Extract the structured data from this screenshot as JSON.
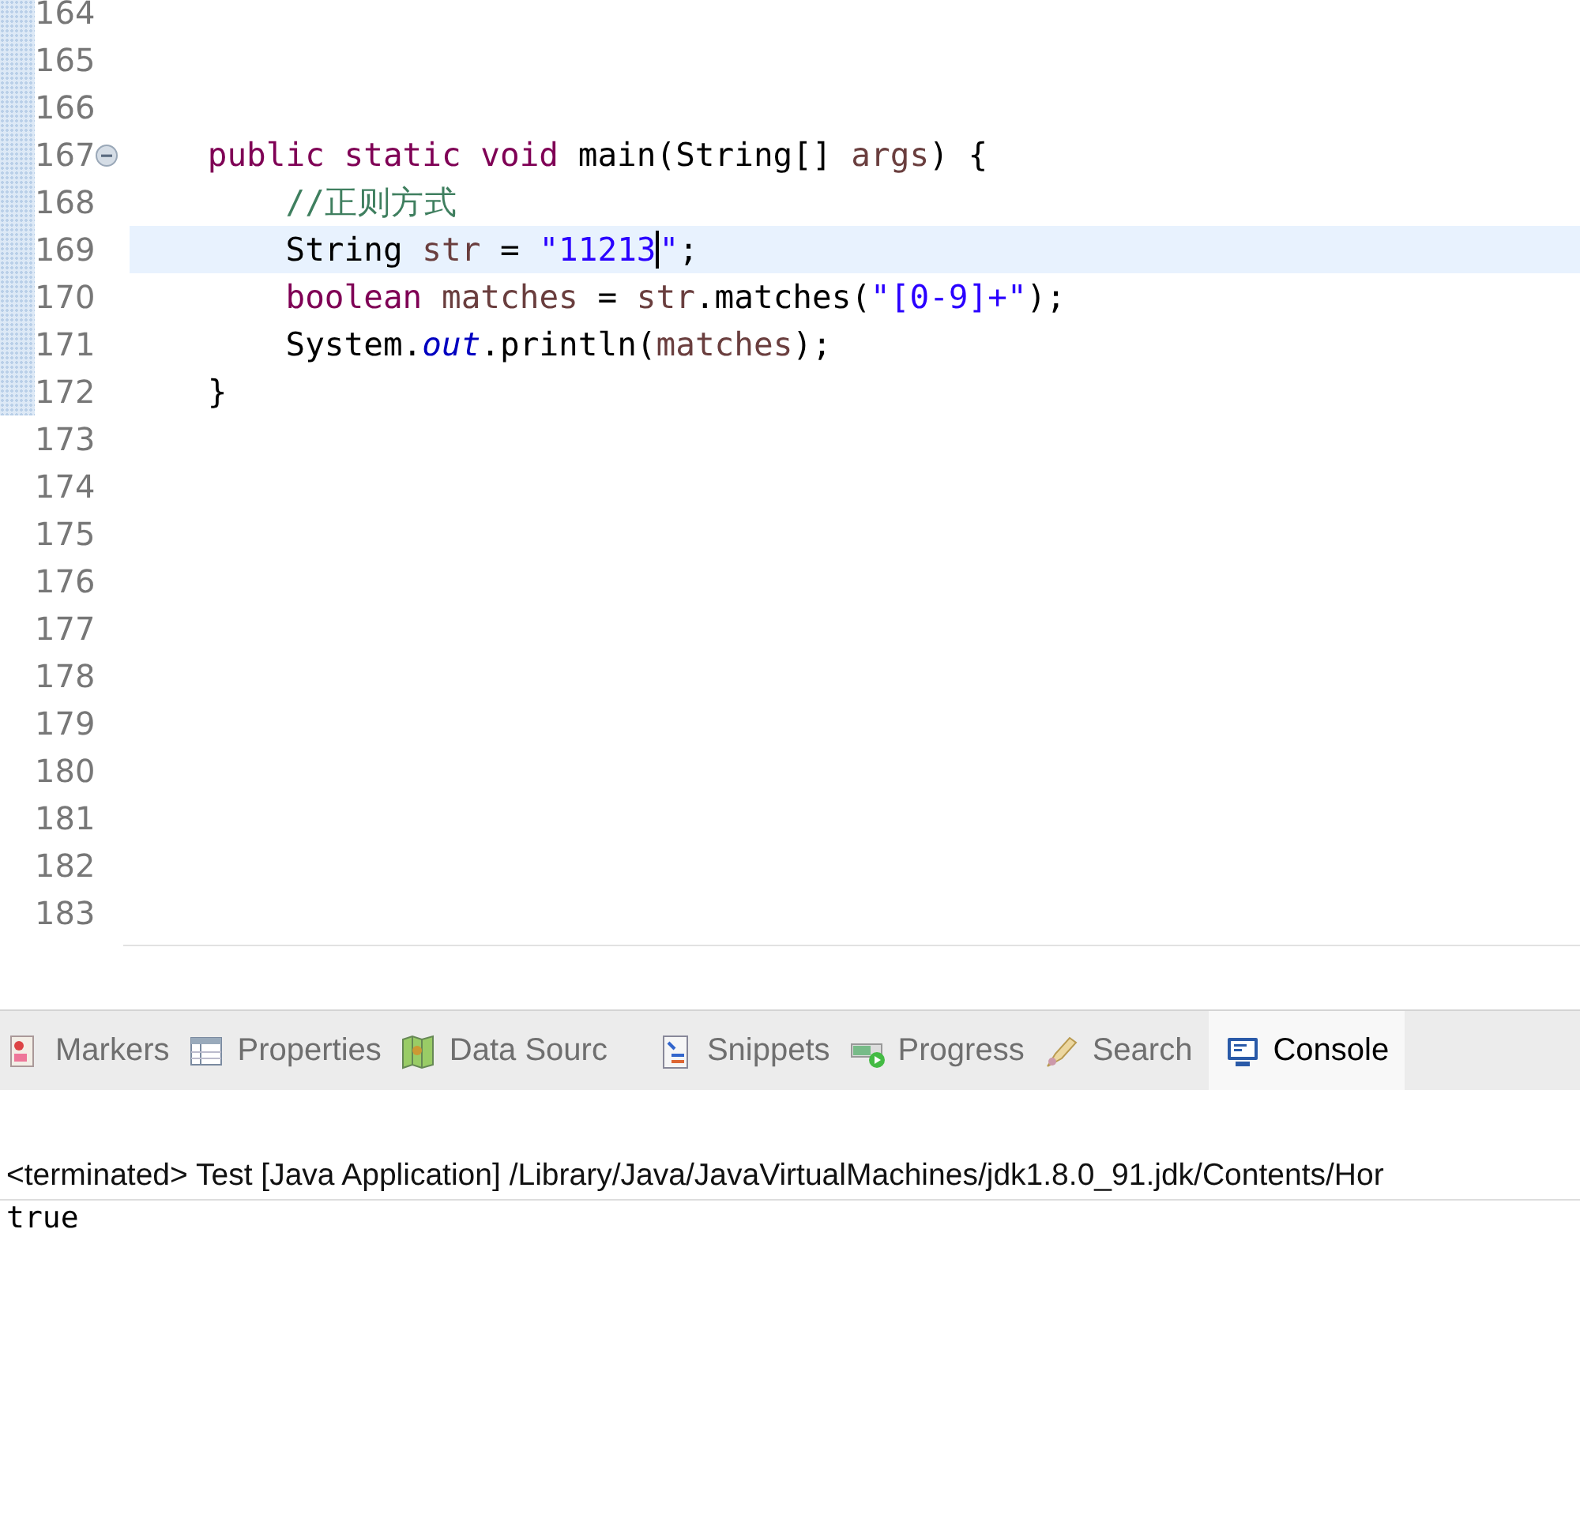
{
  "editor": {
    "lines": [
      {
        "number": "164",
        "current": false,
        "folded": false
      },
      {
        "number": "165",
        "current": false,
        "folded": false
      },
      {
        "number": "166",
        "current": false,
        "folded": false
      },
      {
        "number": "167",
        "current": false,
        "folded": true,
        "tokens": [
          {
            "kind": "keyword",
            "text": "    public static void"
          },
          {
            "kind": "plain",
            "text": " main(String[] "
          },
          {
            "kind": "var",
            "text": "args"
          },
          {
            "kind": "plain",
            "text": ") {"
          }
        ]
      },
      {
        "number": "168",
        "current": false,
        "folded": false,
        "tokens": [
          {
            "kind": "comment",
            "text": "        //正则方式"
          }
        ]
      },
      {
        "number": "169",
        "current": true,
        "folded": false,
        "tokens": [
          {
            "kind": "plain",
            "text": "        String "
          },
          {
            "kind": "var",
            "text": "str"
          },
          {
            "kind": "plain",
            "text": " = "
          },
          {
            "kind": "string",
            "text": "\"11213",
            "caret": true
          },
          {
            "kind": "string",
            "text": "\""
          },
          {
            "kind": "plain",
            "text": ";"
          }
        ]
      },
      {
        "number": "170",
        "current": false,
        "folded": false,
        "tokens": [
          {
            "kind": "keyword",
            "text": "        boolean"
          },
          {
            "kind": "var",
            "text": " matches"
          },
          {
            "kind": "plain",
            "text": " = "
          },
          {
            "kind": "var",
            "text": "str"
          },
          {
            "kind": "plain",
            "text": ".matches("
          },
          {
            "kind": "string",
            "text": "\"[0-9]+\""
          },
          {
            "kind": "plain",
            "text": ");"
          }
        ]
      },
      {
        "number": "171",
        "current": false,
        "folded": false,
        "tokens": [
          {
            "kind": "plain",
            "text": "        System."
          },
          {
            "kind": "field",
            "text": "out"
          },
          {
            "kind": "plain",
            "text": ".println("
          },
          {
            "kind": "var",
            "text": "matches"
          },
          {
            "kind": "plain",
            "text": ");"
          }
        ]
      },
      {
        "number": "172",
        "current": false,
        "folded": false,
        "tokens": [
          {
            "kind": "plain",
            "text": "    }"
          }
        ]
      },
      {
        "number": "173",
        "current": false,
        "folded": false
      },
      {
        "number": "174",
        "current": false,
        "folded": false
      },
      {
        "number": "175",
        "current": false,
        "folded": false
      },
      {
        "number": "176",
        "current": false,
        "folded": false
      },
      {
        "number": "177",
        "current": false,
        "folded": false
      },
      {
        "number": "178",
        "current": false,
        "folded": false
      },
      {
        "number": "179",
        "current": false,
        "folded": false
      },
      {
        "number": "180",
        "current": false,
        "folded": false
      },
      {
        "number": "181",
        "current": false,
        "folded": false
      },
      {
        "number": "182",
        "current": false,
        "folded": false
      },
      {
        "number": "183",
        "current": false,
        "folded": false
      }
    ]
  },
  "tabs": [
    {
      "label": "Markers",
      "kind": "markers",
      "selected": false
    },
    {
      "label": "Properties",
      "kind": "properties",
      "selected": false
    },
    {
      "label": "Data Sourc",
      "kind": "datasource",
      "selected": false
    },
    {
      "label": "Snippets",
      "kind": "snippets",
      "selected": false
    },
    {
      "label": "Progress",
      "kind": "progress",
      "selected": false
    },
    {
      "label": "Search",
      "kind": "search",
      "selected": false
    },
    {
      "label": "Console",
      "kind": "console",
      "selected": true
    }
  ],
  "console": {
    "header": "<terminated> Test [Java Application] /Library/Java/JavaVirtualMachines/jdk1.8.0_91.jdk/Contents/Hor",
    "output": [
      "true"
    ]
  }
}
